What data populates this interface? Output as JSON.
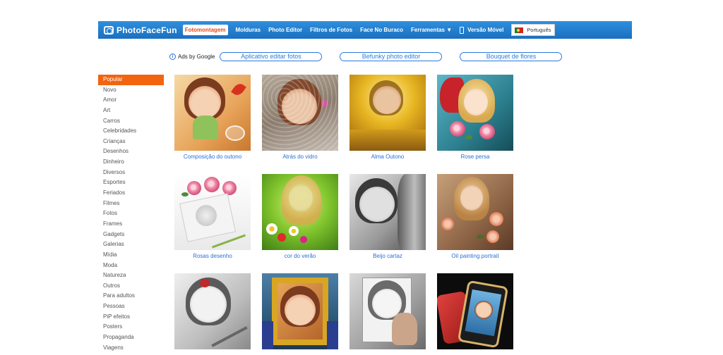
{
  "brand": {
    "logo_text": "PhotoFaceFun"
  },
  "nav": {
    "items": [
      {
        "label": "Fotomontagem",
        "active": true
      },
      {
        "label": "Molduras"
      },
      {
        "label": "Photo Editor"
      },
      {
        "label": "Filtros de Fotos"
      },
      {
        "label": "Face No Buraco"
      },
      {
        "label": "Ferramentas ▼"
      },
      {
        "label": "Versão Móvel"
      }
    ],
    "language": "Português"
  },
  "ads": {
    "label": "Ads by Google",
    "links": [
      "Aplicativo editar fotos",
      "Befunky photo editor",
      "Bouquet de flores"
    ]
  },
  "sidebar": {
    "categories": [
      "Popular",
      "Novo",
      "Amor",
      "Art",
      "Carros",
      "Celebridades",
      "Crianças",
      "Desenhos",
      "Dinheiro",
      "Diversos",
      "Esportes",
      "Feriados",
      "Filmes",
      "Fotos",
      "Frames",
      "Gadgets",
      "Galerias",
      "Mídia",
      "Moda",
      "Natureza",
      "Outros",
      "Para adultos",
      "Pessoas",
      "PiP efeitos",
      "Posters",
      "Propaganda",
      "Viagens"
    ],
    "active": "Popular"
  },
  "gallery": {
    "items": [
      {
        "caption": "Composição do outono"
      },
      {
        "caption": "Atrás do vidro"
      },
      {
        "caption": "Alma Outono"
      },
      {
        "caption": "Rose persa"
      },
      {
        "caption": "Rosas desenho"
      },
      {
        "caption": "cor do verão"
      },
      {
        "caption": "Beijo cartaz"
      },
      {
        "caption": "Oil painting portrait"
      },
      {
        "caption": ""
      },
      {
        "caption": ""
      },
      {
        "caption": ""
      },
      {
        "caption": ""
      }
    ]
  },
  "colors": {
    "topbar": "#1a6fc0",
    "accent_orange": "#f2640f",
    "link_blue": "#2a6fd6"
  }
}
